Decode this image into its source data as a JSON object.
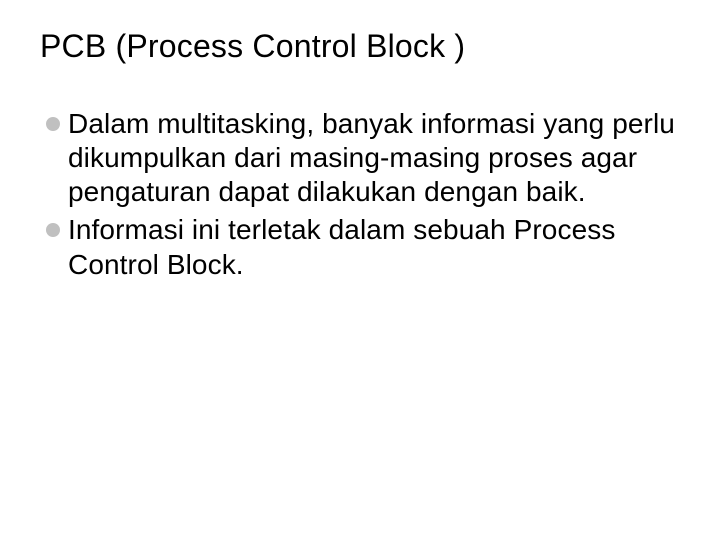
{
  "title": "PCB (Process Control Block )",
  "bullets": [
    "Dalam multitasking, banyak informasi yang perlu dikumpulkan dari masing-masing proses agar pengaturan dapat dilakukan dengan baik.",
    "Informasi ini terletak dalam sebuah Process Control Block."
  ]
}
